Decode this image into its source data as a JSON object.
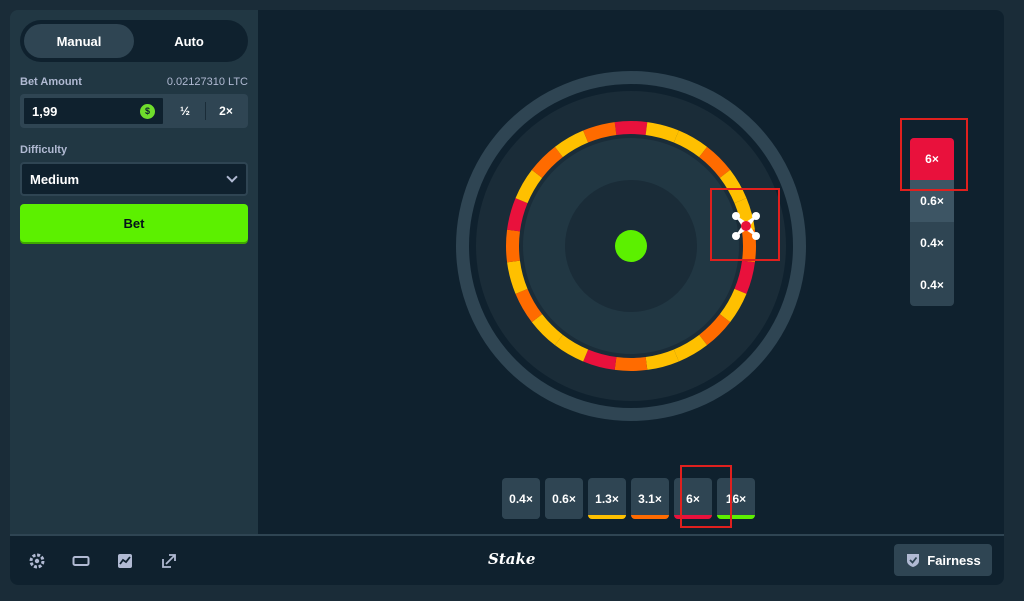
{
  "sidebar": {
    "tabs": [
      {
        "label": "Manual",
        "active": true
      },
      {
        "label": "Auto",
        "active": false
      }
    ],
    "bet_amount": {
      "label": "Bet Amount",
      "balance": "0.02127310 LTC",
      "value": "1,99",
      "coin_icon": "$",
      "half_label": "½",
      "double_label": "2×"
    },
    "difficulty": {
      "label": "Difficulty",
      "selected": "Medium"
    },
    "bet_button": "Bet"
  },
  "history": [
    "6×",
    "0.6×",
    "0.4×",
    "0.4×"
  ],
  "multipliers": [
    {
      "label": "0.4×",
      "color": "#2f4553"
    },
    {
      "label": "0.6×",
      "color": "#2f4553"
    },
    {
      "label": "1.3×",
      "color": "#ffc000"
    },
    {
      "label": "3.1×",
      "color": "#ff6b00"
    },
    {
      "label": "6×",
      "color": "#e9113c"
    },
    {
      "label": "16×",
      "color": "#5cf000"
    }
  ],
  "wheel": {
    "segments": 24,
    "pattern": [
      "#e9113c",
      "#ffc000",
      "#ffc000",
      "#ff6b00",
      "#ffc000",
      "#ffc000",
      "#ff6b00",
      "#e9113c",
      "#ffc000",
      "#ff6b00",
      "#ffc000",
      "#ffc000",
      "#ff6b00",
      "#e9113c",
      "#ffc000",
      "#ffc000",
      "#ff6b00",
      "#ffc000",
      "#ff6b00",
      "#e9113c",
      "#ffc000",
      "#ff6b00",
      "#ffc000",
      "#ff6b00"
    ],
    "center_color": "#5cf000"
  },
  "footer": {
    "brand": "Stake",
    "fairness": "Fairness",
    "icons": [
      "settings-icon",
      "theatre-mode-icon",
      "stats-icon",
      "popout-icon"
    ]
  },
  "colors": {
    "accent_green": "#5cf000",
    "red": "#e9113c",
    "orange": "#ff6b00",
    "yellow": "#ffc000",
    "highlight": "#e0201e"
  }
}
